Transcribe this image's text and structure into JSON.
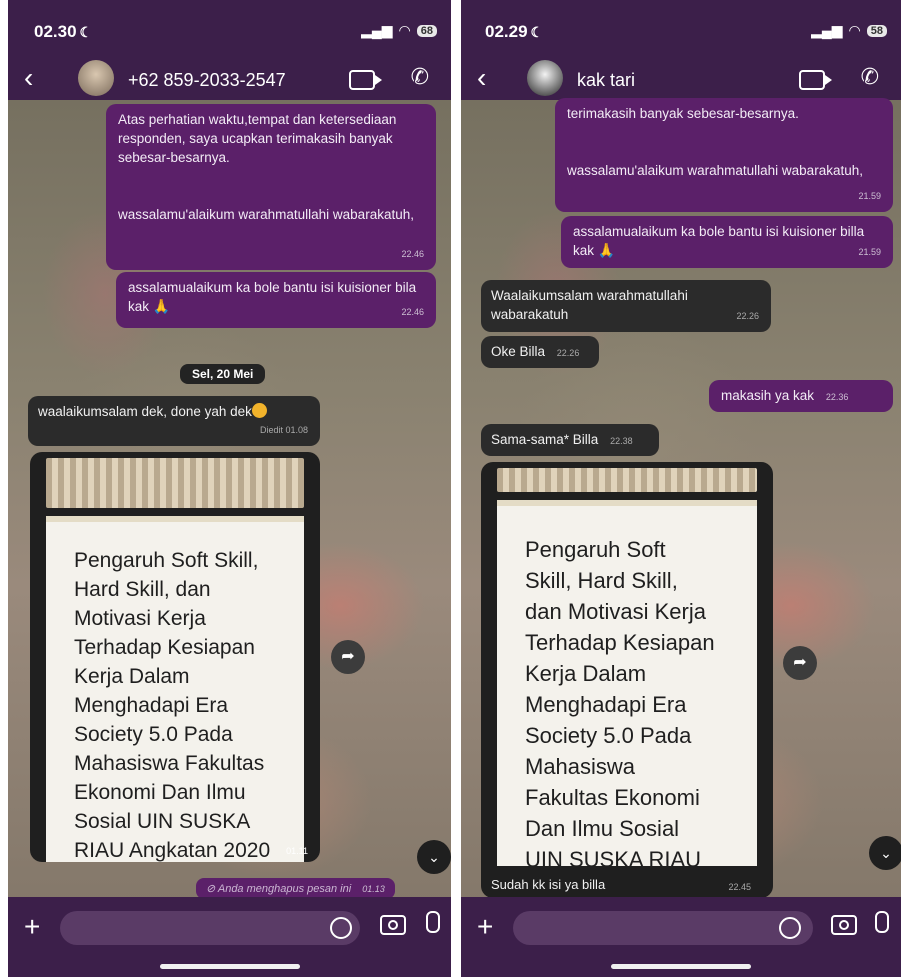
{
  "left": {
    "status_time": "02.30",
    "moon": "☾",
    "signal": "📶",
    "wifi": "≋",
    "battery": "68",
    "back": "‹",
    "contact": "+62 859-2033-2547",
    "messages": {
      "m1_text": "Atas perhatian waktu,tempat dan ketersediaan responden, saya ucapkan terimakasih banyak sebesar-besarnya.\n\n\nwassalamu'alaikum warahmatullahi wabarakatuh,",
      "m1_time": "22.46",
      "m2_text": "assalamualaikum ka bole bantu isi kuisioner bila kak",
      "m2_time": "22.46",
      "date_pill": "Sel, 20 Mei",
      "m3_text": "waalaikumsalam dek, done yah dek",
      "m3_time": "Diedit 01.08",
      "card_text": "Pengaruh Soft Skill,\nHard Skill, dan\nMotivasi Kerja\nTerhadap Kesiapan\nKerja Dalam\nMenghadapi Era\nSociety 5.0 Pada\nMahasiswa Fakultas\nEkonomi Dan Ilmu\nSosial UIN SUSKA\nRIAU Angkatan 2020",
      "card_time": "01.11",
      "deleted_text": "⊘ Anda menghapus pesan ini",
      "deleted_time": "01.13"
    }
  },
  "right": {
    "status_time": "02.29",
    "moon": "☾",
    "battery": "58",
    "back": "‹",
    "contact": "kak tari",
    "messages": {
      "m1_text": "terimakasih banyak sebesar-besarnya.\n\n\nwassalamu'alaikum warahmatullahi wabarakatuh,",
      "m1_time": "21.59",
      "m2_text": "assalamualaikum ka bole bantu isi kuisioner billa kak",
      "m2_time": "21.59",
      "m3_text": "Waalaikumsalam warahmatullahi wabarakatuh",
      "m3_time": "22.26",
      "m4_text": "Oke Billa",
      "m4_time": "22.26",
      "m5_text": "makasih ya kak",
      "m5_time": "22.36",
      "m6_text": "Sama-sama* Billa",
      "m6_time": "22.38",
      "card_text": "Pengaruh Soft\nSkill, Hard Skill,\ndan Motivasi Kerja\nTerhadap Kesiapan\nKerja Dalam\nMenghadapi Era\nSociety 5.0 Pada\nMahasiswa\nFakultas Ekonomi\nDan Ilmu Sosial\nUIN SUSKA RIAU",
      "caption_text": "Sudah kk isi ya billa",
      "caption_time": "22.45"
    }
  },
  "icons": {
    "back": "chevron-left-icon",
    "video": "video-camera-icon",
    "phone": "phone-icon",
    "forward": "forward-icon",
    "scroll_down": "chevron-down-icon",
    "plus": "plus-icon",
    "sticker": "sticker-icon",
    "camera": "camera-icon",
    "mic": "microphone-icon"
  },
  "colors": {
    "header": "#3c1f4a",
    "outgoing_bubble": "#5b2069",
    "incoming_bubble": "#2b2b2b"
  }
}
